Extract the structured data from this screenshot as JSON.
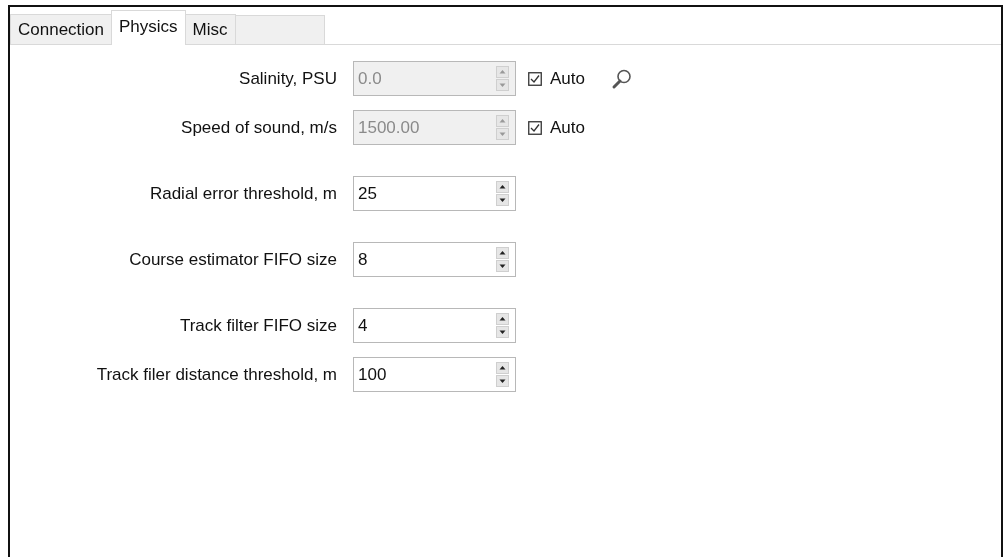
{
  "tabs": [
    {
      "label": "Connection",
      "selected": false
    },
    {
      "label": "Physics",
      "selected": true
    },
    {
      "label": "Misc",
      "selected": false
    }
  ],
  "groups": [
    {
      "rows": [
        {
          "label": "Salinity, PSU",
          "value": "0.0",
          "disabled": true,
          "auto": {
            "label": "Auto",
            "checked": true
          },
          "lookup": true
        },
        {
          "label": "Speed of sound, m/s",
          "value": "1500.00",
          "disabled": true,
          "auto": {
            "label": "Auto",
            "checked": true
          }
        }
      ]
    },
    {
      "rows": [
        {
          "label": "Radial error threshold, m",
          "value": "25",
          "disabled": false
        }
      ]
    },
    {
      "rows": [
        {
          "label": "Course estimator FIFO size",
          "value": "8",
          "disabled": false
        }
      ]
    },
    {
      "rows": [
        {
          "label": "Track filter FIFO size",
          "value": "4",
          "disabled": false
        },
        {
          "label": "Track filer distance threshold, m",
          "value": "100",
          "disabled": false
        }
      ]
    }
  ]
}
